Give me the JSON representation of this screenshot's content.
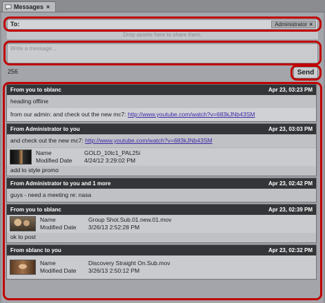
{
  "tab": {
    "label": "Messages",
    "close": "×"
  },
  "compose": {
    "to_label": "To:",
    "recipient": "Administrator",
    "recipient_remove": "×",
    "drop_hint": "Drop assets here to share them.",
    "message_placeholder": "Write a message...",
    "char_count": "256",
    "send_label": "Send"
  },
  "messages": [
    {
      "header": "From you to sblanc",
      "date": "Apr 23, 03:23 PM",
      "lines": [
        "heading offline"
      ],
      "link_prefix": "from our admin: and check out the new mc7: ",
      "link": "http://www.youtube.com/watch?v=683kJNb43SM"
    },
    {
      "header": "From Administrator to you",
      "date": "Apr 23, 03:03 PM",
      "link_prefix": "and check out the new mc7: ",
      "link": "http://www.youtube.com/watch?v=683kJNb43SM",
      "asset": {
        "name_label": "Name",
        "name": "GOLD_10tc1_PAL25i",
        "date_label": "Modified Date",
        "date": "4/24/12 3:29:02 PM"
      },
      "note": "add to style promo"
    },
    {
      "header": "From Administrator to you and 1 more",
      "date": "Apr 23, 02:42 PM",
      "text": "guys - need a meeting re: nasa"
    },
    {
      "header": "From you to sblanc",
      "date": "Apr 23, 02:39 PM",
      "asset": {
        "name_label": "Name",
        "name": "Group Shot.Sub.01.new.01.mov",
        "date_label": "Modified Date",
        "date": "3/26/13 2:52:28 PM"
      },
      "note": "ok to post"
    },
    {
      "header": "From sblanc to you",
      "date": "Apr 23, 02:32 PM",
      "asset": {
        "name_label": "Name",
        "name": "Discovery Straight On.Sub.mov",
        "date_label": "Modified Date",
        "date": "3/26/13 2:50:12 PM"
      }
    }
  ]
}
